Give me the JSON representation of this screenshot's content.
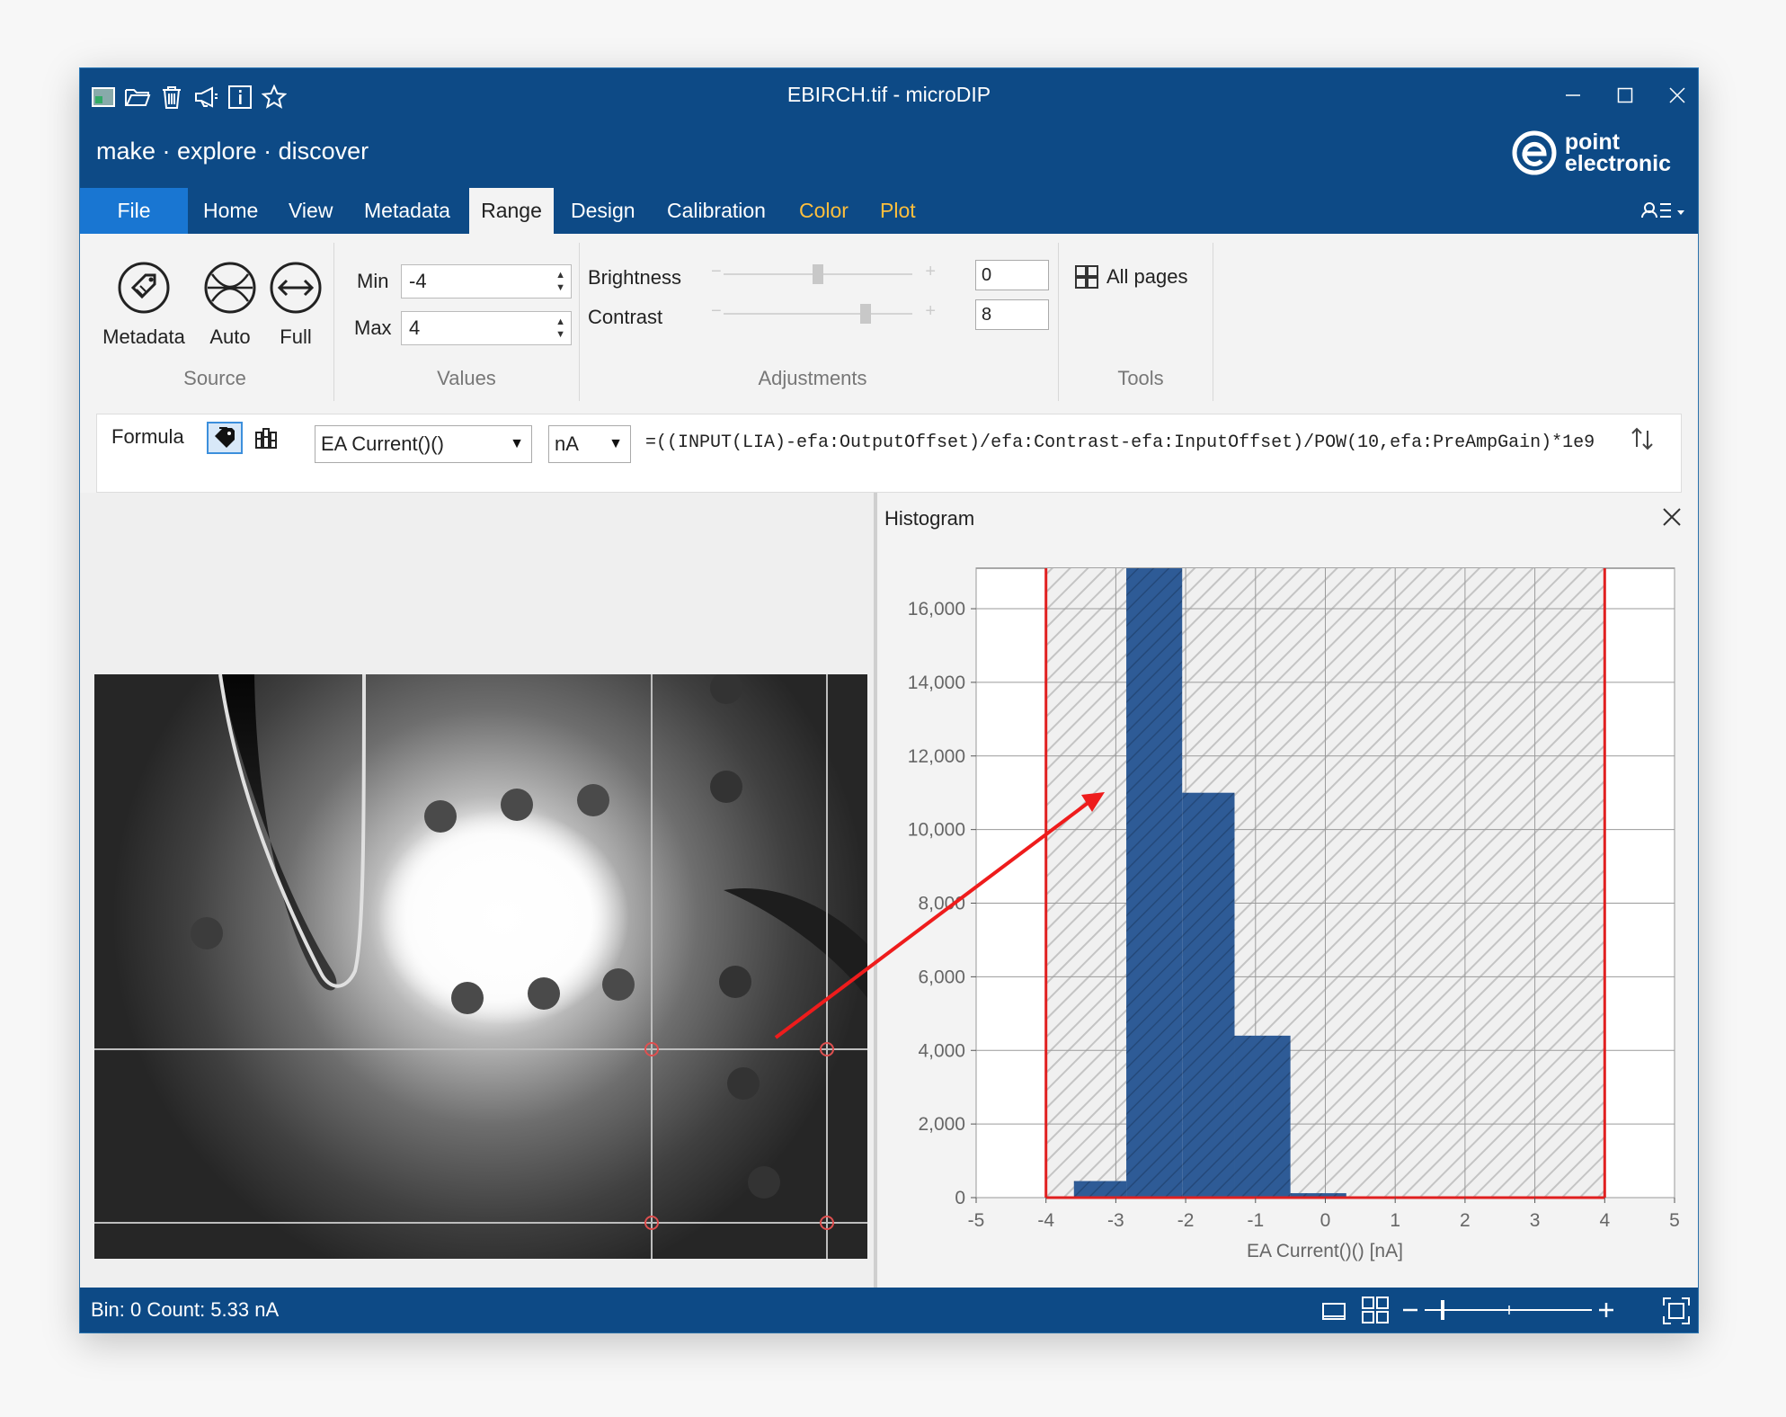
{
  "window": {
    "title": "EBIRCH.tif - microDIP",
    "tagline": "make · explore · discover",
    "logo_line1": "point",
    "logo_line2": "electronic"
  },
  "quick_access": [
    "image-icon",
    "open-folder-icon",
    "delete-icon",
    "megaphone-icon",
    "info-icon",
    "star-icon"
  ],
  "tabs": [
    {
      "label": "File"
    },
    {
      "label": "Home"
    },
    {
      "label": "View"
    },
    {
      "label": "Metadata"
    },
    {
      "label": "Range"
    },
    {
      "label": "Design"
    },
    {
      "label": "Calibration"
    },
    {
      "label": "Color"
    },
    {
      "label": "Plot"
    }
  ],
  "ribbon": {
    "source": {
      "label": "Source",
      "metadata": "Metadata",
      "auto": "Auto",
      "full": "Full"
    },
    "values": {
      "label": "Values",
      "min_label": "Min",
      "min_value": "-4",
      "max_label": "Max",
      "max_value": "4"
    },
    "adjustments": {
      "label": "Adjustments",
      "brightness_label": "Brightness",
      "brightness_value": "0",
      "contrast_label": "Contrast",
      "contrast_value": "8",
      "brightness_level": 0.5,
      "contrast_level": 0.75
    },
    "tools": {
      "label": "Tools",
      "all_pages": "All pages"
    }
  },
  "formula_bar": {
    "label": "Formula",
    "channel": "EA Current()()",
    "unit": "nA",
    "expression": "=((INPUT(LIA)-efa:OutputOffset)/efa:Contrast-efa:InputOffset)/POW(10,efa:PreAmpGain)*1e9"
  },
  "histogram_panel": {
    "title": "Histogram"
  },
  "chart_data": {
    "type": "bar",
    "xlabel": "EA Current()() [nA]",
    "ylabel": "",
    "xlim": [
      -5,
      5
    ],
    "ylim": [
      0,
      17100
    ],
    "xticks": [
      -5,
      -4,
      -3,
      -2,
      -1,
      0,
      1,
      2,
      3,
      4,
      5
    ],
    "yticks": [
      0,
      2000,
      4000,
      6000,
      8000,
      10000,
      12000,
      14000,
      16000
    ],
    "ytick_labels": [
      "0",
      "2,000",
      "4,000",
      "6,000",
      "8,000",
      "10,000",
      "12,000",
      "14,000",
      "16,000"
    ],
    "bins": [
      {
        "x0": -3.6,
        "x1": -2.85,
        "count": 450
      },
      {
        "x0": -2.85,
        "x1": -2.05,
        "count": 17100
      },
      {
        "x0": -2.05,
        "x1": -1.3,
        "count": 11000
      },
      {
        "x0": -1.3,
        "x1": -0.5,
        "count": 4400
      },
      {
        "x0": -0.5,
        "x1": 0.3,
        "count": 120
      }
    ],
    "range_min": -4,
    "range_max": 4,
    "colors": {
      "bar": "#2e5b96",
      "range_line": "#e02020"
    }
  },
  "status": {
    "text": "Bin: 0  Count: 5.33 nA"
  }
}
